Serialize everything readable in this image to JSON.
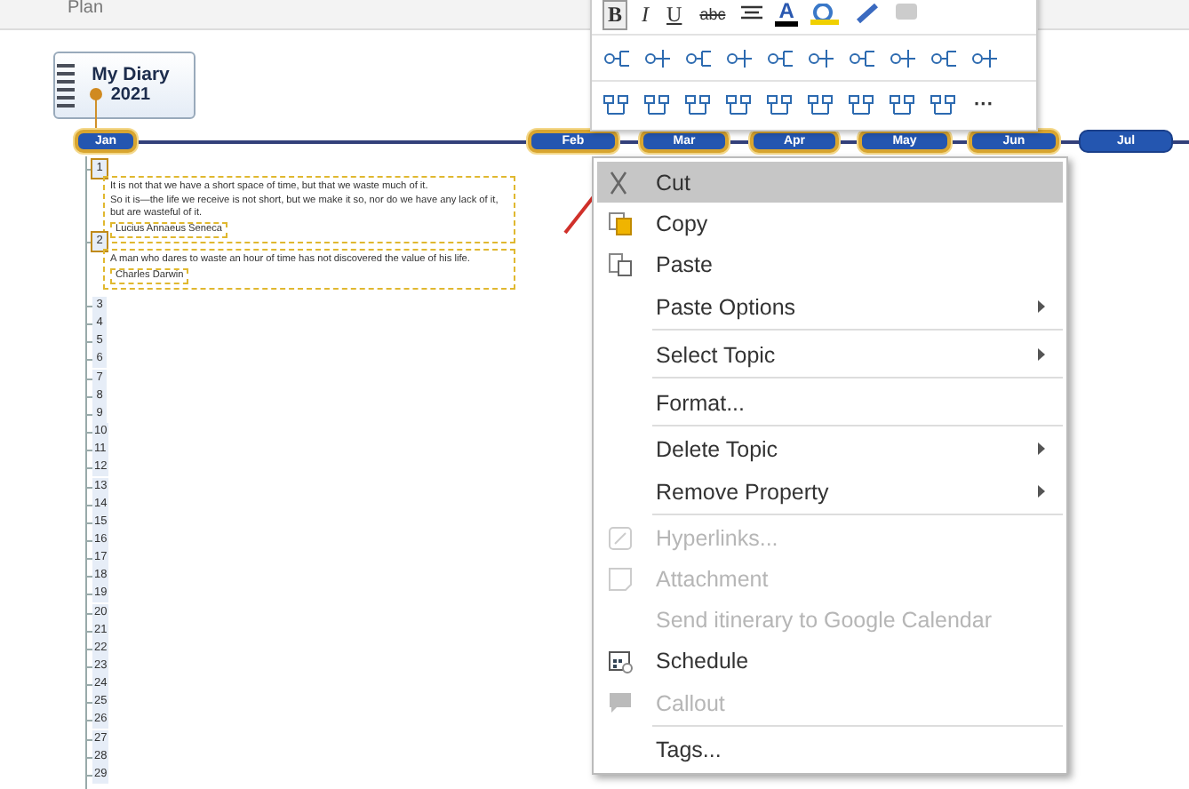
{
  "header": {
    "tab": "Plan"
  },
  "toolbar": {
    "text_buttons": [
      {
        "label": "B",
        "selected": true
      },
      {
        "label": "I",
        "selected": false
      },
      {
        "label": "U",
        "selected": false
      },
      {
        "label": "abc",
        "selected": false
      }
    ],
    "font_color_label": "A",
    "more_label": "···"
  },
  "diagram": {
    "title": "My Diary",
    "year": "2021",
    "months": [
      {
        "label": "Jan",
        "selected": true
      },
      {
        "label": "Feb",
        "selected": true
      },
      {
        "label": "Mar",
        "selected": true
      },
      {
        "label": "Apr",
        "selected": true
      },
      {
        "label": "May",
        "selected": true
      },
      {
        "label": "Jun",
        "selected": true
      },
      {
        "label": "Jul",
        "selected": false
      }
    ],
    "days": [
      {
        "label": "1",
        "selected": true,
        "note": {
          "lines": [
            "It is not that we have a short space of time, but that we waste much of it.",
            "So it is—the life we receive is not short, but we make it so, nor do we have any lack of it, but are wasteful of it."
          ],
          "author": "Lucius  Annaeus  Seneca"
        }
      },
      {
        "label": "2",
        "selected": true,
        "note": {
          "lines": [
            "A man who dares to waste an hour of time has not discovered the value of his life."
          ],
          "author": "Charles  Darwin"
        }
      },
      {
        "label": "3",
        "selected": false
      },
      {
        "label": "4",
        "selected": false
      },
      {
        "label": "5",
        "selected": false
      },
      {
        "label": "6",
        "selected": false
      },
      {
        "label": "7",
        "selected": false
      },
      {
        "label": "8",
        "selected": false
      },
      {
        "label": "9",
        "selected": false
      },
      {
        "label": "10",
        "selected": false
      },
      {
        "label": "11",
        "selected": false
      },
      {
        "label": "12",
        "selected": false
      },
      {
        "label": "13",
        "selected": false
      },
      {
        "label": "14",
        "selected": false
      },
      {
        "label": "15",
        "selected": false
      },
      {
        "label": "16",
        "selected": false
      },
      {
        "label": "17",
        "selected": false
      },
      {
        "label": "18",
        "selected": false
      },
      {
        "label": "19",
        "selected": false
      },
      {
        "label": "20",
        "selected": false
      },
      {
        "label": "21",
        "selected": false
      },
      {
        "label": "22",
        "selected": false
      },
      {
        "label": "23",
        "selected": false
      },
      {
        "label": "24",
        "selected": false
      },
      {
        "label": "25",
        "selected": false
      },
      {
        "label": "26",
        "selected": false
      },
      {
        "label": "27",
        "selected": false
      },
      {
        "label": "28",
        "selected": false
      },
      {
        "label": "29",
        "selected": false
      }
    ]
  },
  "context_menu": {
    "items": [
      {
        "label": "Cut",
        "selected": true,
        "disabled": false,
        "submenu": false,
        "separator_after": false
      },
      {
        "label": "Copy",
        "selected": false,
        "disabled": false,
        "submenu": false,
        "separator_after": false
      },
      {
        "label": "Paste",
        "selected": false,
        "disabled": false,
        "submenu": false,
        "separator_after": false
      },
      {
        "label": "Paste Options",
        "selected": false,
        "disabled": false,
        "submenu": true,
        "separator_after": true
      },
      {
        "label": "Select Topic",
        "selected": false,
        "disabled": false,
        "submenu": true,
        "separator_after": true
      },
      {
        "label": "Format...",
        "selected": false,
        "disabled": false,
        "submenu": false,
        "separator_after": true
      },
      {
        "label": "Delete Topic",
        "selected": false,
        "disabled": false,
        "submenu": true,
        "separator_after": false
      },
      {
        "label": "Remove  Property",
        "selected": false,
        "disabled": false,
        "submenu": true,
        "separator_after": true
      },
      {
        "label": "Hyperlinks...",
        "selected": false,
        "disabled": true,
        "submenu": false,
        "separator_after": false
      },
      {
        "label": "Attachment",
        "selected": false,
        "disabled": true,
        "submenu": false,
        "separator_after": false
      },
      {
        "label": "Send itinerary to Google Calendar",
        "selected": false,
        "disabled": true,
        "submenu": false,
        "separator_after": false
      },
      {
        "label": "Schedule",
        "selected": false,
        "disabled": false,
        "submenu": false,
        "separator_after": false
      },
      {
        "label": "Callout",
        "selected": false,
        "disabled": true,
        "submenu": false,
        "separator_after": true
      },
      {
        "label": "Tags...",
        "selected": false,
        "disabled": false,
        "submenu": false,
        "separator_after": false
      }
    ]
  }
}
